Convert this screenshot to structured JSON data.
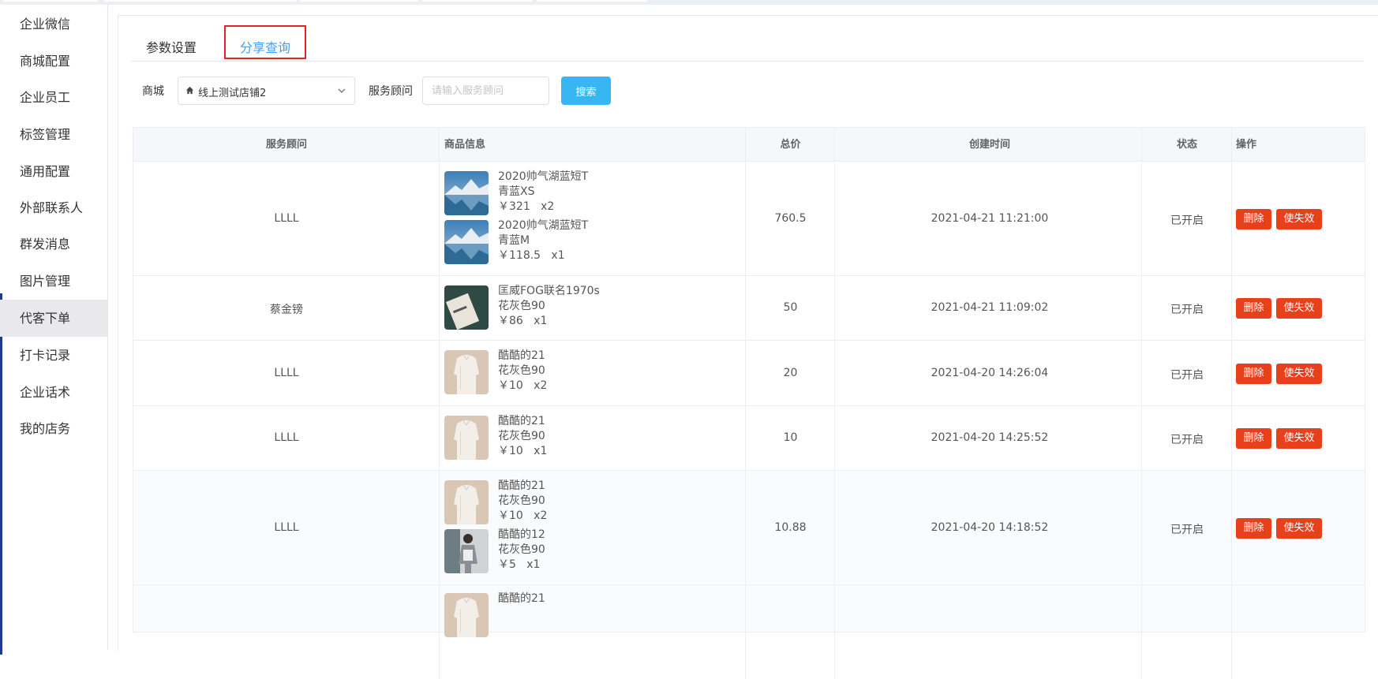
{
  "sidebar": {
    "items": [
      "企业微信",
      "商城配置",
      "企业员工",
      "标签管理",
      "通用配置",
      "外部联系人",
      "群发消息",
      "图片管理",
      "代客下单",
      "打卡记录",
      "企业话术",
      "我的店务"
    ],
    "active_index": 8
  },
  "tabs": [
    "参数设置",
    "分享查询"
  ],
  "active_tab": 1,
  "filters": {
    "mall_label": "商城",
    "mall_value": "线上测试店铺2",
    "advisor_label": "服务顾问",
    "advisor_placeholder": "请输入服务顾问",
    "search_label": "搜索"
  },
  "table": {
    "headers": [
      "服务顾问",
      "商品信息",
      "总价",
      "创建时间",
      "状态",
      "操作"
    ],
    "delete_label": "删除",
    "invalidate_label": "使失效",
    "rows": [
      {
        "advisor": "LLLL",
        "total": "760.5",
        "time": "2021-04-21 11:21:00",
        "status": "已开启",
        "products": [
          {
            "name": "2020帅气湖蓝短T",
            "spec": "青蓝XS",
            "price": "￥321   x2",
            "thumb": "mountain"
          },
          {
            "name": "2020帅气湖蓝短T",
            "spec": "青蓝M",
            "price": "￥118.5   x1",
            "thumb": "mountain"
          }
        ]
      },
      {
        "advisor": "蔡金镑",
        "total": "50",
        "time": "2021-04-21 11:09:02",
        "status": "已开启",
        "products": [
          {
            "name": "匡威FOG联名1970s",
            "spec": "花灰色90",
            "price": "￥86   x1",
            "thumb": "card"
          }
        ]
      },
      {
        "advisor": "LLLL",
        "total": "20",
        "time": "2021-04-20 14:26:04",
        "status": "已开启",
        "products": [
          {
            "name": "酷酷的21",
            "spec": "花灰色90",
            "price": "￥10   x2",
            "thumb": "shirt"
          }
        ]
      },
      {
        "advisor": "LLLL",
        "total": "10",
        "time": "2021-04-20 14:25:52",
        "status": "已开启",
        "products": [
          {
            "name": "酷酷的21",
            "spec": "花灰色90",
            "price": "￥10   x1",
            "thumb": "shirt"
          }
        ]
      },
      {
        "advisor": "LLLL",
        "total": "10.88",
        "time": "2021-04-20 14:18:52",
        "status": "已开启",
        "products": [
          {
            "name": "酷酷的21",
            "spec": "花灰色90",
            "price": "￥10   x2",
            "thumb": "shirt"
          },
          {
            "name": "酷酷的12",
            "spec": "花灰色90",
            "price": "￥5   x1",
            "thumb": "person"
          }
        ]
      },
      {
        "advisor": "",
        "total": "",
        "time": "",
        "status": "",
        "products": [
          {
            "name": "酷酷的21",
            "spec": "",
            "price": "",
            "thumb": "shirt"
          }
        ]
      }
    ]
  },
  "colors": {
    "accent": "#409eff",
    "search_button": "#38b6f4",
    "danger": "#e8401c",
    "highlight_box": "#e02424"
  }
}
